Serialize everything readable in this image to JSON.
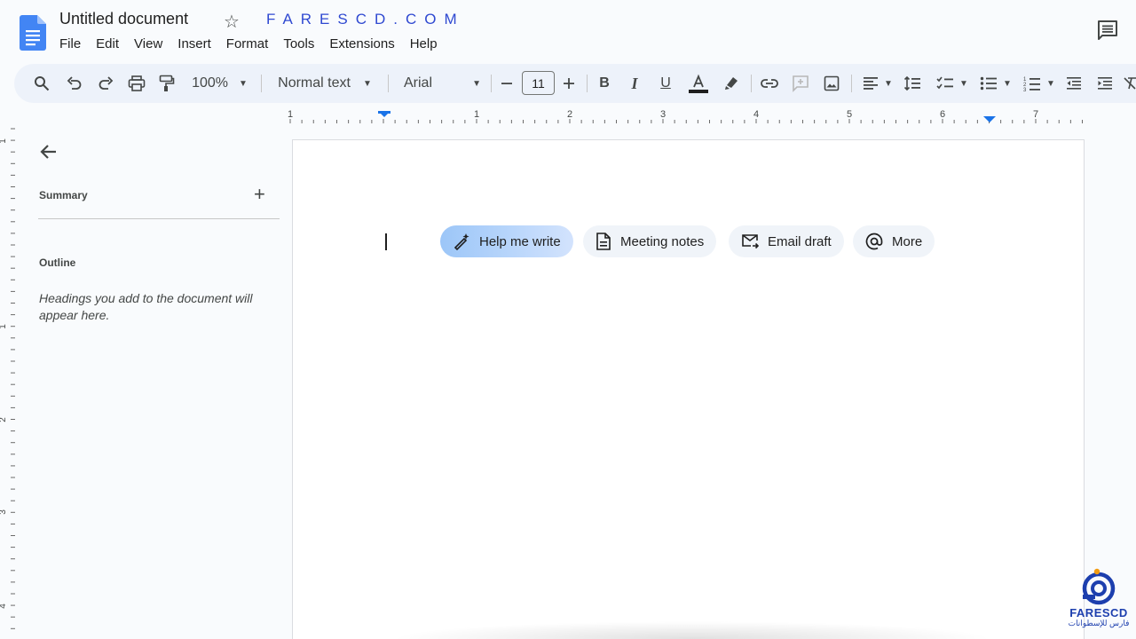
{
  "app": {
    "title": "Untitled document",
    "watermark_text": "FARESCD.COM"
  },
  "menu": [
    "File",
    "Edit",
    "View",
    "Insert",
    "Format",
    "Tools",
    "Extensions",
    "Help"
  ],
  "toolbar": {
    "zoom": "100%",
    "style": "Normal text",
    "font": "Arial",
    "font_size": "11",
    "icons": [
      "search-icon",
      "undo-icon",
      "redo-icon",
      "print-icon",
      "paint-format-icon",
      "decrease-size-icon",
      "increase-size-icon",
      "bold-icon",
      "italic-icon",
      "underline-icon",
      "text-color-icon",
      "highlight-icon",
      "link-icon",
      "comment-add-icon",
      "image-icon",
      "align-icon",
      "line-spacing-icon",
      "checklist-icon",
      "bullet-list-icon",
      "numbered-list-icon",
      "indent-decrease-icon",
      "indent-increase-icon",
      "clear-format-icon"
    ]
  },
  "ruler": {
    "labels": [
      "1",
      "1",
      "2",
      "3",
      "4",
      "5",
      "6",
      "7"
    ],
    "vertical_labels": [
      "1",
      "1",
      "2",
      "3",
      "4"
    ]
  },
  "sidebar": {
    "summary_label": "Summary",
    "summary_add": "+",
    "outline_label": "Outline",
    "outline_hint": "Headings you add to the document will appear here."
  },
  "chips": [
    {
      "label": "Help me write",
      "icon": "pen-sparkle-icon"
    },
    {
      "label": "Meeting notes",
      "icon": "document-icon"
    },
    {
      "label": "Email draft",
      "icon": "email-icon"
    },
    {
      "label": "More",
      "icon": "at-icon"
    }
  ],
  "corner_logo": {
    "name": "FARESCD",
    "subtitle": "فارس للإسطوانات"
  },
  "colors": {
    "accent": "#1a73e8",
    "toolbar_bg": "#edf2fa",
    "watermark": "#2f49d1",
    "chip_gradient_start": "#9cc6f8"
  }
}
